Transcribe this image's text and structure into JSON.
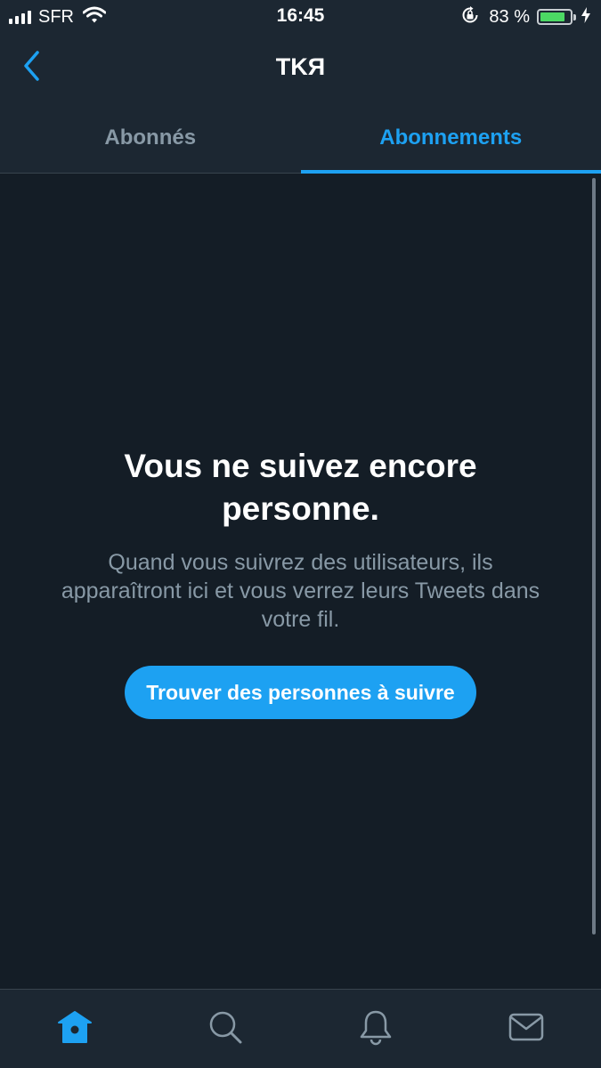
{
  "status_bar": {
    "carrier": "SFR",
    "time": "16:45",
    "battery_percent": "83 %",
    "battery_level": 0.83
  },
  "header": {
    "title": "TKЯ",
    "back_icon": "chevron-left-icon"
  },
  "tabs": [
    {
      "label": "Abonnés",
      "active": false
    },
    {
      "label": "Abonnements",
      "active": true
    }
  ],
  "empty_state": {
    "title": "Vous ne suivez encore personne.",
    "text": "Quand vous suivrez des utilisateurs, ils apparaîtront ici et vous verrez leurs Tweets dans votre fil.",
    "button_label": "Trouver des personnes à suivre"
  },
  "tab_bar": {
    "items": [
      {
        "icon": "home-icon",
        "active": true
      },
      {
        "icon": "search-icon",
        "active": false
      },
      {
        "icon": "bell-icon",
        "active": false
      },
      {
        "icon": "mail-icon",
        "active": false
      }
    ]
  },
  "colors": {
    "background": "#141d26",
    "bar_background": "#1c2732",
    "accent": "#1da1f2",
    "secondary_text": "#8899a6",
    "battery": "#4cd964"
  }
}
